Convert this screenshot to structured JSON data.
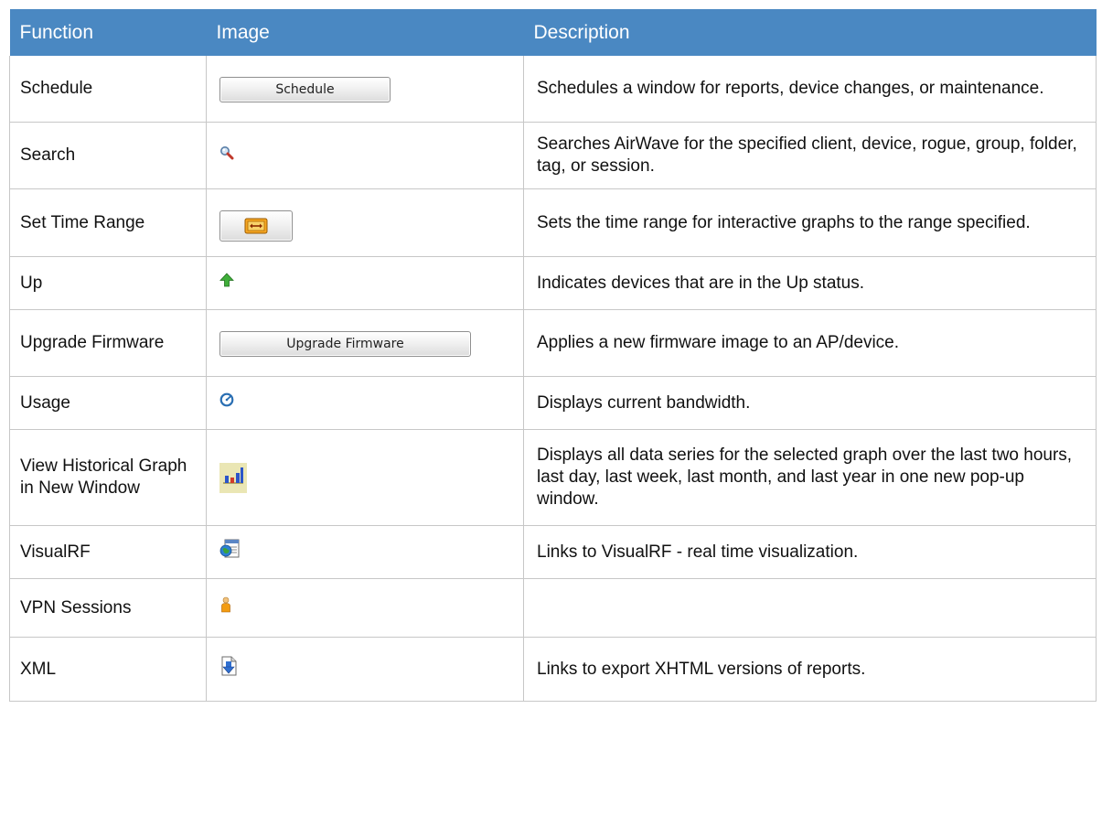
{
  "table": {
    "headers": {
      "function": "Function",
      "image": "Image",
      "description": "Description"
    },
    "rows": [
      {
        "function": "Schedule",
        "button": "Schedule",
        "icon": "schedule-button",
        "description": "Schedules a window for reports, device changes, or maintenance."
      },
      {
        "function": "Search",
        "icon": "search-icon",
        "description": "Searches AirWave for the specified client, device, rogue, group, folder, tag, or session."
      },
      {
        "function": "Set Time Range",
        "icon": "time-range-icon",
        "description": "Sets the time range for interactive graphs to the range specified."
      },
      {
        "function": "Up",
        "icon": "up-arrow-icon",
        "description": "Indicates devices that are in the Up status."
      },
      {
        "function": "Upgrade Firmware",
        "button": "Upgrade Firmware",
        "icon": "upgrade-firmware-button",
        "description": "Applies a new firmware image to an AP/device."
      },
      {
        "function": "Usage",
        "icon": "usage-gauge-icon",
        "description": "Displays current bandwidth."
      },
      {
        "function": "View Historical Graph in New Window",
        "icon": "bar-chart-icon",
        "description": "Displays all data series for the selected graph over the last two hours, last day, last week, last month, and last year in one new pop-up window."
      },
      {
        "function": "VisualRF",
        "icon": "visualrf-icon",
        "description": "Links to VisualRF - real time visualization."
      },
      {
        "function": "VPN Sessions",
        "icon": "vpn-user-icon",
        "description": ""
      },
      {
        "function": "XML",
        "icon": "xml-export-icon",
        "description": "Links to export XHTML versions of reports."
      }
    ]
  },
  "colors": {
    "header_bg": "#4a88c2",
    "header_text": "#ffffff",
    "border": "#c7c7c7"
  }
}
